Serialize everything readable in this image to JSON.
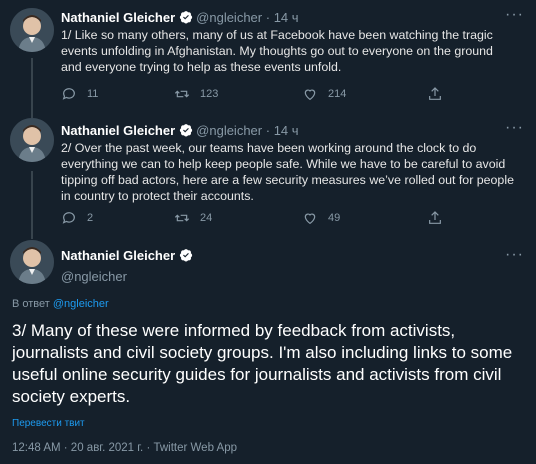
{
  "tweets": [
    {
      "name": "Nathaniel Gleicher",
      "handle": "@ngleicher",
      "time": "14 ч",
      "text": "1/ Like so many others, many of us at Facebook have been watching the tragic events unfolding in Afghanistan. My thoughts go out to everyone on the ground and everyone trying to help as these events unfold.",
      "replies": "11",
      "retweets": "123",
      "likes": "214"
    },
    {
      "name": "Nathaniel Gleicher",
      "handle": "@ngleicher",
      "time": "14 ч",
      "text": "2/ Over the past week, our teams have been working around the clock to do everything we can to help keep people safe. While we have to be careful to avoid tipping off bad actors, here are a few security measures we’ve rolled out for people in country to protect their accounts.",
      "replies": "2",
      "retweets": "24",
      "likes": "49"
    }
  ],
  "main_tweet": {
    "name": "Nathaniel Gleicher",
    "handle": "@ngleicher",
    "reply_prefix": "В ответ",
    "reply_handle": "@ngleicher",
    "text": "3/ Many of these were informed by feedback from activists, journalists and civil society groups. I'm also including links to some useful online security guides for journalists and activists from civil society experts.",
    "translate": "Перевести твит",
    "timestamp": "12:48 AM · 20 авг. 2021 г. · Twitter Web App"
  },
  "ui": {
    "separator": "·",
    "more": "···"
  },
  "colors": {
    "background": "#15202b",
    "accent": "#1d9bf0",
    "muted": "#8899a6"
  },
  "icons": [
    "reply-icon",
    "retweet-icon",
    "like-icon",
    "share-icon",
    "verified-badge-icon",
    "more-icon"
  ]
}
